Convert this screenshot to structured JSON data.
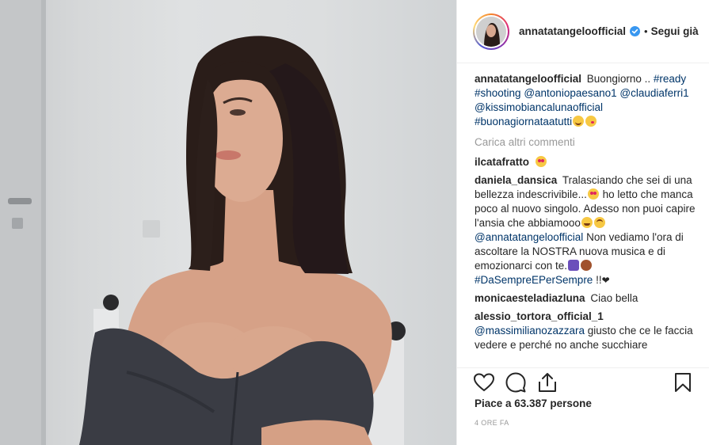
{
  "post": {
    "username": "annatatangeloofficial",
    "verified_icon": "verified-badge-icon",
    "separator": "•",
    "follow_label": "Segui già",
    "load_more_label": "Carica altri commenti",
    "likes_label": "Piace a 63.387 persone",
    "time_label": "4 ORE FA"
  },
  "caption": {
    "username": "annatatangeloofficial",
    "text_1": "Buongiorno ..",
    "tag_ready": "#ready",
    "tag_shooting": "#shooting",
    "mention_antonio": "@antoniopaesano1",
    "mention_claudia": "@claudiaferri1",
    "mention_kissimo": "@kissimobiancalunaofficial",
    "tag_buonagiornata": "#buonagiornataatutti"
  },
  "comments": [
    {
      "username": "ilcatafratto"
    },
    {
      "username": "daniela_dansica",
      "text_1": "Tralasciando che sei di una bellezza indescrivibile...",
      "text_2": "ho letto che manca poco al nuovo singolo. Adesso non puoi capire l'ansia che abbiamooo",
      "mention": "@annatatangeloofficial",
      "text_3": "Non vediamo l'ora di ascoltare la NOSTRA nuova musica e di emozionarci con te.",
      "tag": "#DaSempreEPerSempre",
      "text_4": "!!"
    },
    {
      "username": "monicaesteladiazluna",
      "text": "Ciao bella"
    },
    {
      "username": "alessio_tortora_official_1",
      "mention": "@massimilianozazzara",
      "text": "giusto che ce le faccia vedere e perché no anche succhiare"
    }
  ],
  "icons": {
    "like": "heart-icon",
    "comment": "comment-icon",
    "share": "share-icon",
    "save": "bookmark-icon"
  },
  "colors": {
    "link": "#003569",
    "muted": "#999999",
    "text": "#262626",
    "border": "#efefef",
    "verified": "#3897f0"
  }
}
